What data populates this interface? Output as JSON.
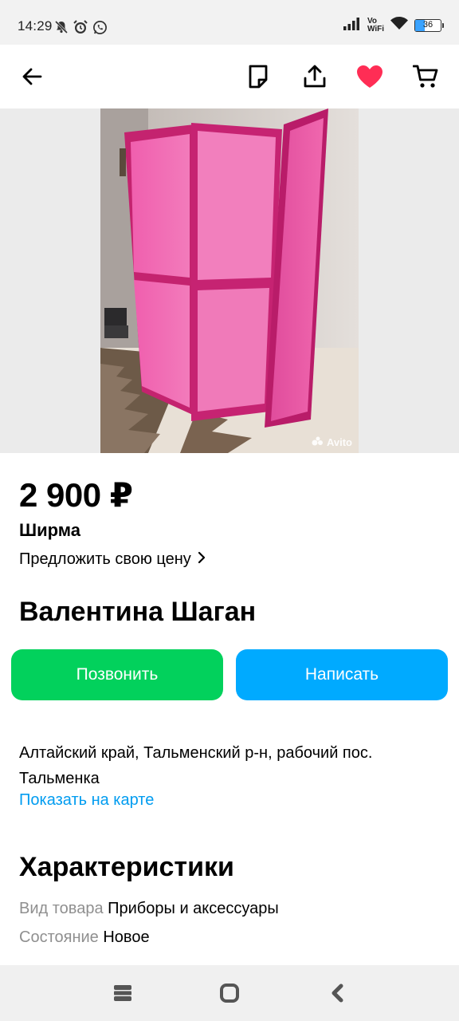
{
  "status_bar": {
    "time": "14:29",
    "network_label_top": "Vo",
    "network_label_bottom": "WiFi",
    "battery_level": "36",
    "battery_percent": 36
  },
  "app_bar": {
    "icons": [
      "arrow-left-icon",
      "note-icon",
      "share-icon",
      "heart-icon",
      "cart-icon"
    ],
    "favorite_color": "#ff2d55"
  },
  "listing": {
    "photo_watermark": "Avito",
    "price": "2 900 ₽",
    "title": "Ширма",
    "offer_price_label": "Предложить свою цену"
  },
  "seller": {
    "name": "Валентина Шаган"
  },
  "actions": {
    "call_label": "Позвонить",
    "write_label": "Написать",
    "call_color": "#02d15c",
    "write_color": "#00aaff"
  },
  "location": {
    "address": "Алтайский край, Тальменский р-н, рабочий пос. Тальменка",
    "map_link": "Показать на карте",
    "link_color": "#009cf0"
  },
  "specs": {
    "heading": "Характеристики",
    "items": [
      {
        "key": "Вид товара",
        "value": "Приборы и аксессуары"
      },
      {
        "key": "Состояние",
        "value": "Новое"
      }
    ]
  },
  "nav_bar": {
    "icons": [
      "recent-apps-icon",
      "home-icon",
      "back-icon"
    ]
  }
}
